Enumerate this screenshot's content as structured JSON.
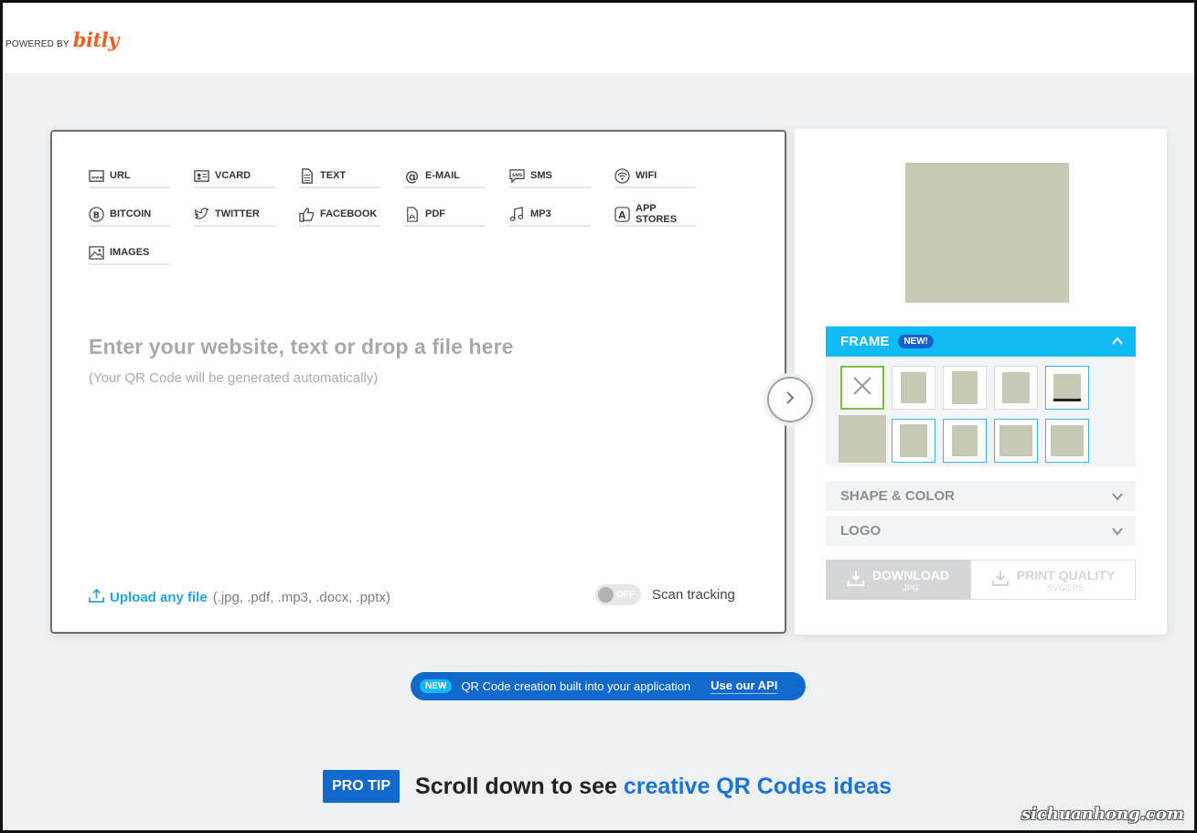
{
  "header": {
    "powered_by": "POWERED BY",
    "brand": "bitly"
  },
  "types": [
    {
      "label": "URL",
      "icon": "www-icon"
    },
    {
      "label": "VCARD",
      "icon": "vcard-icon"
    },
    {
      "label": "TEXT",
      "icon": "text-doc-icon"
    },
    {
      "label": "E-MAIL",
      "icon": "at-icon"
    },
    {
      "label": "SMS",
      "icon": "sms-icon"
    },
    {
      "label": "WIFI",
      "icon": "wifi-icon"
    },
    {
      "label": "BITCOIN",
      "icon": "bitcoin-icon"
    },
    {
      "label": "TWITTER",
      "icon": "twitter-icon"
    },
    {
      "label": "FACEBOOK",
      "icon": "thumbs-up-icon"
    },
    {
      "label": "PDF",
      "icon": "pdf-icon"
    },
    {
      "label": "MP3",
      "icon": "music-note-icon"
    },
    {
      "label": "APP STORES",
      "icon": "app-store-icon"
    },
    {
      "label": "IMAGES",
      "icon": "image-icon"
    }
  ],
  "input": {
    "placeholder": "Enter your website, text or drop a file here",
    "hint": "(Your QR Code will be generated automatically)"
  },
  "upload": {
    "link": "Upload any file",
    "extensions": "(.jpg, .pdf, .mp3, .docx, .pptx)"
  },
  "tracking": {
    "state": "OFF",
    "label": "Scan tracking"
  },
  "panel": {
    "frame_title": "FRAME",
    "frame_badge": "NEW!",
    "shape_color": "SHAPE & COLOR",
    "logo": "LOGO",
    "download_label": "DOWNLOAD",
    "download_sub": "JPG",
    "print_label": "PRINT QUALITY",
    "print_sub": "SVG/EPS"
  },
  "api_banner": {
    "badge": "NEW",
    "text": "QR Code creation built into your application",
    "link": "Use our API"
  },
  "pro_tip": {
    "badge": "PRO TIP",
    "text": "Scroll down to see",
    "highlight": "creative QR Codes ideas"
  },
  "watermark": "sichuanhong.com",
  "colors": {
    "accent": "#10bbf3",
    "brand_blue": "#1269cc",
    "bitly_orange": "#ee6123",
    "preview": "#c8c8b7"
  }
}
